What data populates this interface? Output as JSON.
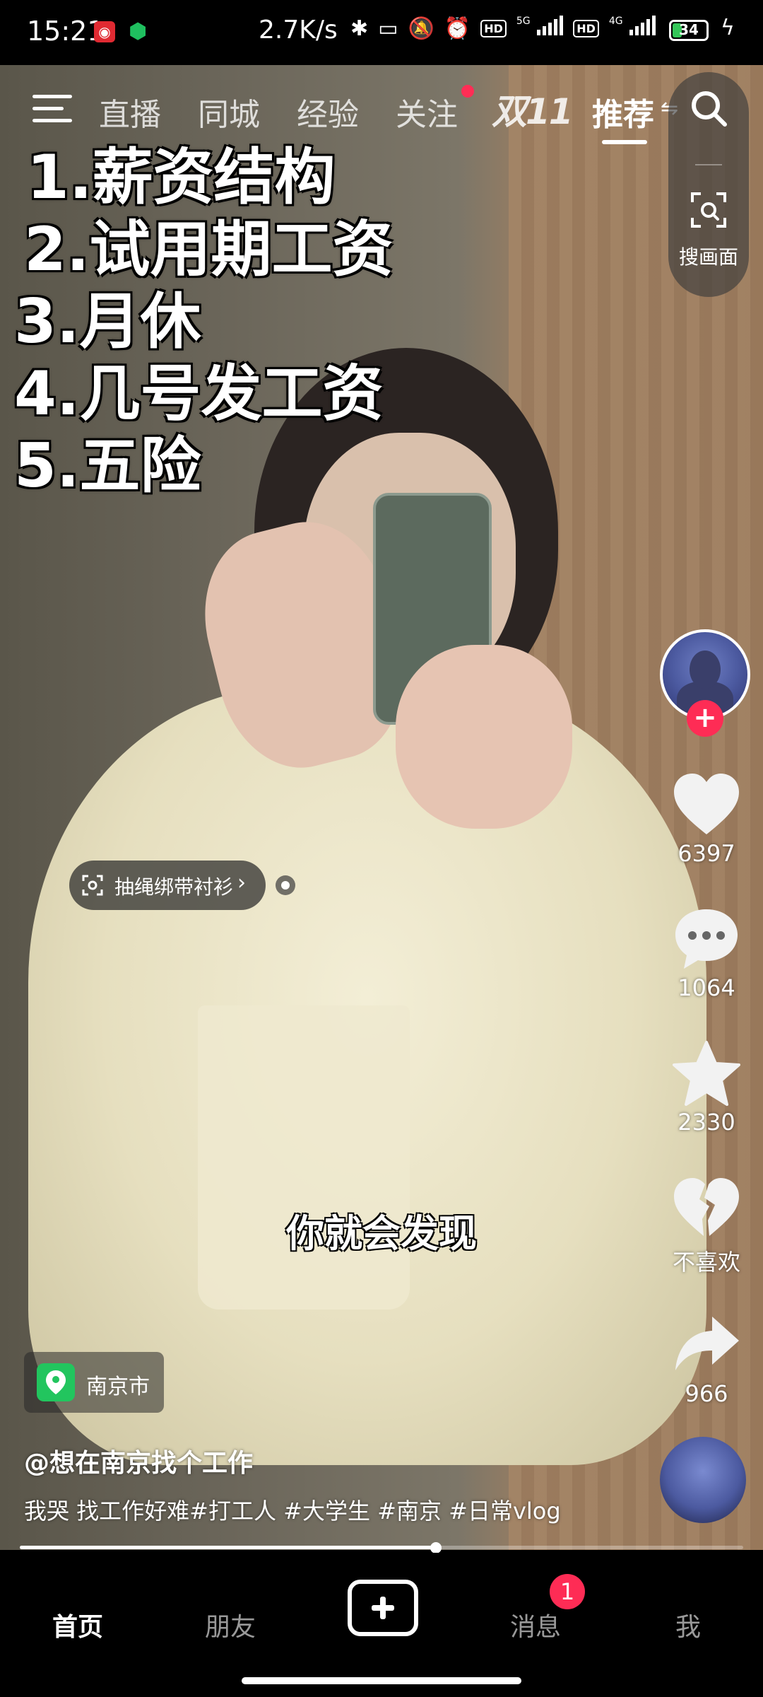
{
  "status_bar": {
    "time": "15:21",
    "network_speed": "2.7K/s",
    "network_1": "5G",
    "network_2": "4G",
    "hd_label": "HD",
    "battery": "34",
    "icons": [
      "app-notification-icon",
      "shield-icon",
      "bluetooth-icon",
      "vibrate-icon",
      "mute-icon",
      "alarm-icon",
      "signal-icon",
      "battery-icon",
      "charging-icon"
    ]
  },
  "top_tabs": {
    "items": [
      "直播",
      "同城",
      "经验",
      "关注"
    ],
    "promo": "双11",
    "active": "推荐",
    "follow_has_dot": true
  },
  "search_pill": {
    "scan_label": "搜画面"
  },
  "overlay_list": [
    "1.薪资结构",
    "2.试用期工资",
    "3.月休",
    "4.几号发工资",
    "5.五险"
  ],
  "product_tag": {
    "label": "抽绳绑带衬衫"
  },
  "subtitle": "你就会发现",
  "actions": {
    "likes": "6397",
    "comments": "1064",
    "favorites": "2330",
    "dislike": "不喜欢",
    "shares": "966"
  },
  "location": {
    "label": "南京市"
  },
  "author": "@想在南京找个工作",
  "caption": "我哭  找工作好难#打工人 #大学生 #南京 #日常vlog",
  "playback": {
    "progress": 0.575
  },
  "bottom_nav": {
    "home": "首页",
    "friends": "朋友",
    "messages": "消息",
    "messages_badge": "1",
    "me": "我"
  },
  "colors": {
    "accent": "#fe2c55",
    "location_green": "#22c55e"
  }
}
